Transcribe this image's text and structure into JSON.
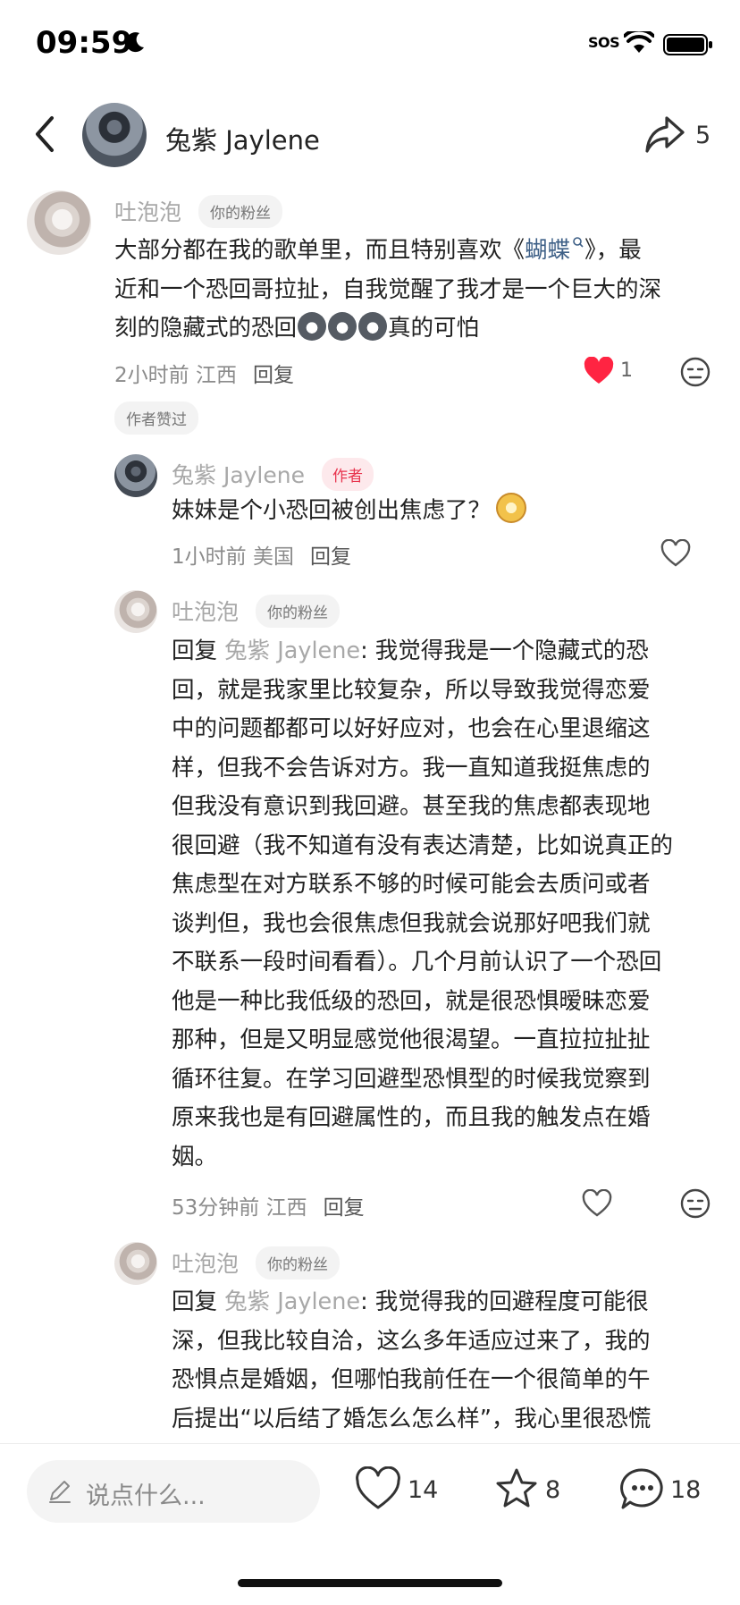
{
  "status_bar": {
    "time": "09:59",
    "sos": "SOS"
  },
  "header": {
    "author_name": "兔紫 Jaylene",
    "share_count": "5"
  },
  "comments": [
    {
      "user": "吐泡泡",
      "tag": "你的粉丝",
      "line1_a": "大部分都在我的歌单里，而且特别喜欢《",
      "song": "蝴蝶",
      "line1_b": "》，最",
      "line2": "近和一个恐回哥拉扯，自我觉醒了我才是一个巨大的深",
      "line3_a": "刻的隐藏式的恐回",
      "line3_b": "真的可怕",
      "time": "2小时前 江西",
      "reply": "回复",
      "likes": "1",
      "author_liked": "作者赞过"
    },
    {
      "user": "兔紫 Jaylene",
      "tag": "作者",
      "text": "妹妹是个小恐回被创出焦虑了？",
      "time": "1小时前 美国",
      "reply": "回复"
    },
    {
      "user": "吐泡泡",
      "tag": "你的粉丝",
      "reply_prefix": "回复",
      "reply_to": "兔紫 Jaylene",
      "lines": [
        ": 我觉得我是一个隐藏式的恐",
        "回，就是我家里比较复杂，所以导致我觉得恋爱",
        "中的问题都都可以好好应对，也会在心里退缩这",
        "样，但我不会告诉对方。我一直知道我挺焦虑的",
        "但我没有意识到我回避。甚至我的焦虑都表现地",
        "很回避（我不知道有没有表达清楚，比如说真正的",
        "焦虑型在对方联系不够的时候可能会去质问或者",
        "谈判但，我也会很焦虑但我就会说那好吧我们就",
        "不联系一段时间看看）。几个月前认识了一个恐回",
        "他是一种比我低级的恐回，就是很恐惧暧昧恋爱",
        "那种，但是又明显感觉他很渴望。一直拉拉扯扯",
        "循环往复。在学习回避型恐惧型的时候我觉察到",
        "原来我也是有回避属性的，而且我的触发点在婚",
        "姻。"
      ],
      "time": "53分钟前 江西",
      "reply": "回复"
    },
    {
      "user": "吐泡泡",
      "tag": "你的粉丝",
      "reply_prefix": "回复",
      "reply_to": "兔紫 Jaylene",
      "lines": [
        ": 我觉得我的回避程度可能很",
        "深，但我比较自洽，这么多年适应过来了，我的",
        "恐惧点是婚姻，但哪怕我前任在一个很简单的午",
        "后提出“以后结了婚怎么怎么样”，我心里很恐慌"
      ]
    }
  ],
  "bottom_bar": {
    "input_placeholder": "说点什么...",
    "likes": "14",
    "favorites": "8",
    "comments": "18"
  },
  "colors": {
    "heart_red": "#ff2442",
    "author_tag": "#e8344e",
    "song_link": "#3d5f86"
  }
}
